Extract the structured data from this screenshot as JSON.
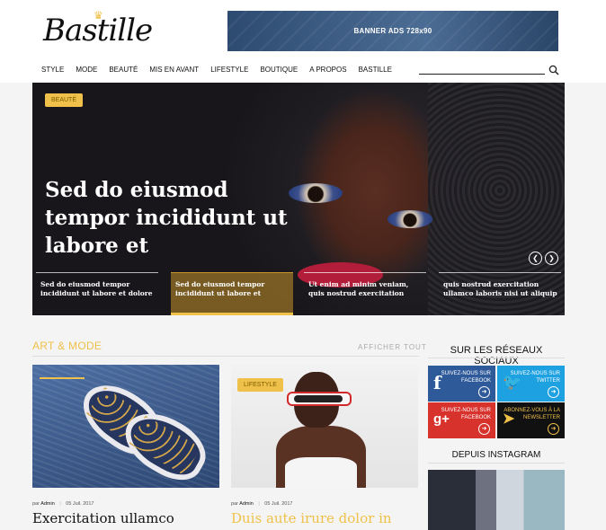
{
  "header": {
    "logo": "Bastille",
    "banner_text": "BANNER ADS 728x90",
    "nav": [
      "STYLE",
      "MODE",
      "BEAUTÉ",
      "MIS EN AVANT",
      "LIFESTYLE",
      "BOUTIQUE",
      "A PROPOS",
      "BASTILLE"
    ],
    "search": {
      "placeholder": "",
      "icon": "search-icon"
    }
  },
  "hero": {
    "category": "BEAUTÉ",
    "headline": "Sed do eiusmod tempor incididunt ut labore et",
    "prev_icon": "chevron-left-icon",
    "next_icon": "chevron-right-icon",
    "slides": [
      {
        "title": "Sed do eiusmod tempor incididunt ut labore et dolore",
        "active": false
      },
      {
        "title": "Sed do eiusmod tempor incididunt ut labore et",
        "active": true
      },
      {
        "title": "Ut enim ad minim veniam, quis nostrud exercitation",
        "active": false
      },
      {
        "title": "quis nostrud exercitation ullamco laboris nisi ut aliquip",
        "active": false
      }
    ]
  },
  "section": {
    "title": "ART & MODE",
    "view_all": "AFFICHER TOUT",
    "cards": [
      {
        "tag": "",
        "author_prefix": "par",
        "author": "Admin",
        "date": "05 Juil. 2017",
        "title": "Exercitation ullamco"
      },
      {
        "tag": "LIFESTYLE",
        "author_prefix": "par",
        "author": "Admin",
        "date": "05 Juil. 2017",
        "title": "Duis aute irure dolor in"
      }
    ]
  },
  "sidebar": {
    "social_title": "SUR LES RÉSEAUX SOCIAUX",
    "social": [
      {
        "label": "SUIVEZ-NOUS SUR FACEBOOK",
        "icon": "facebook-icon",
        "color": "#2f5a9a"
      },
      {
        "label": "SUIVEZ-NOUS SUR TWITTER",
        "icon": "twitter-icon",
        "color": "#1da1e0"
      },
      {
        "label": "SUIVEZ-NOUS SUR FACEBOOK",
        "icon": "google-plus-icon",
        "color": "#d8322d"
      },
      {
        "label": "ABONNEZ-VOUS À LA NEWSLETTER",
        "icon": "paper-plane-icon",
        "color": "#111111"
      }
    ],
    "instagram_title": "DEPUIS INSTAGRAM"
  },
  "colors": {
    "accent": "#f0c14a",
    "banner": "#3e5f86"
  }
}
